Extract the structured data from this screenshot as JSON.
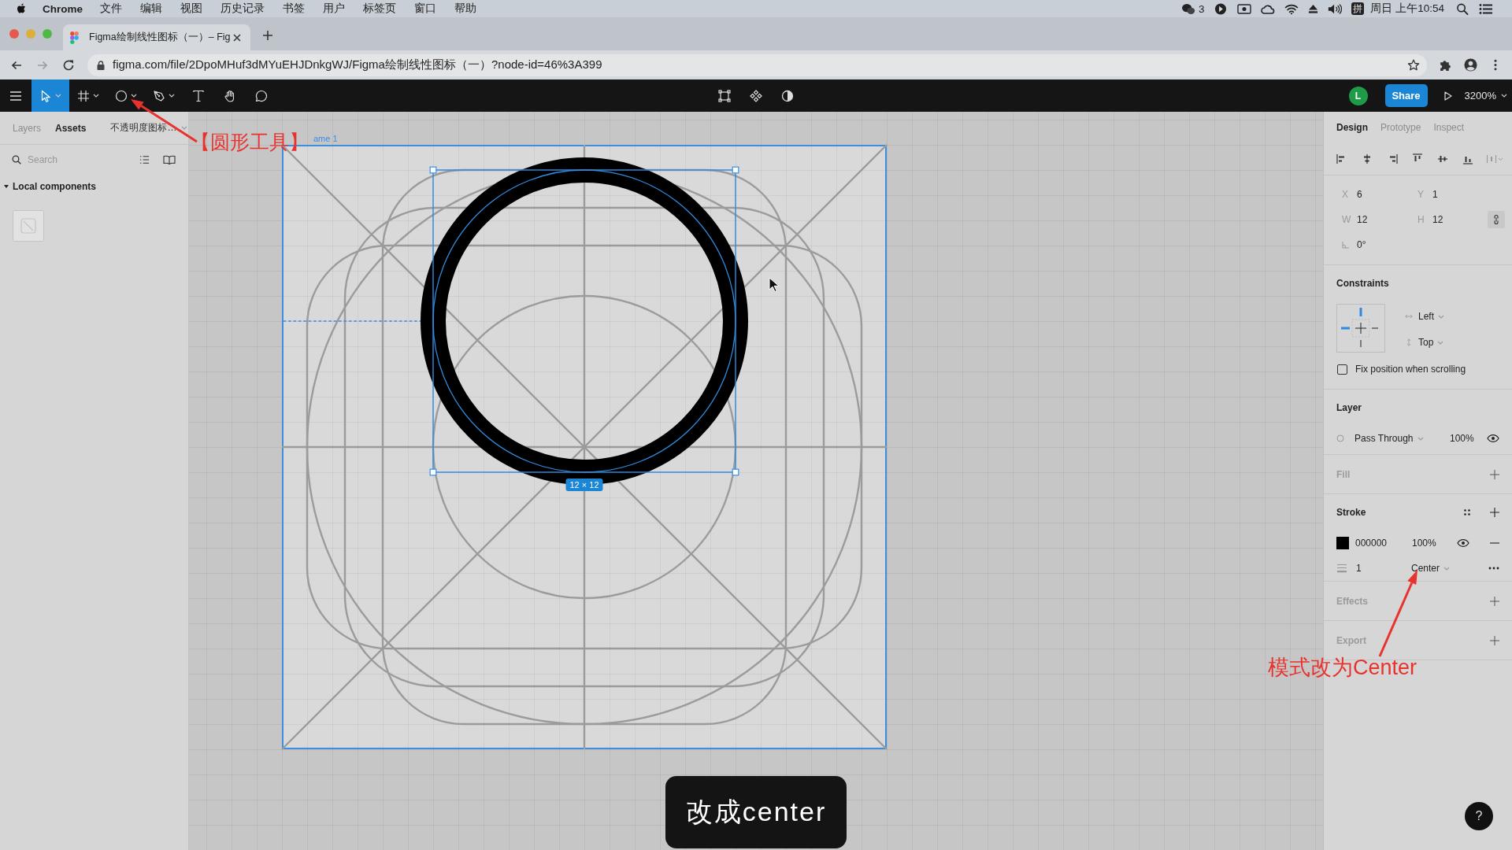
{
  "menu_bar": {
    "app": "Chrome",
    "menus": [
      "文件",
      "编辑",
      "视图",
      "历史记录",
      "书签",
      "用户",
      "标签页",
      "窗口",
      "帮助"
    ],
    "chat_count": "3",
    "input_method": "拼",
    "clock": "周日 上午10:54"
  },
  "browser": {
    "tabs": [
      {
        "title": "Figma绘制线性图标（一）– Fig",
        "selected": true
      }
    ],
    "forward_disabled": true,
    "url": "figma.com/file/2DpoMHuf3dMYuEHJDnkgWJ/Figma绘制线性图标（一）?node-id=46%3A399"
  },
  "toolbar": {
    "tools": [
      {
        "selected": true
      },
      {
        "selected": false
      },
      {
        "selected": false
      },
      {
        "selected": false
      },
      {
        "selected": false
      },
      {
        "selected": false
      },
      {
        "selected": false
      }
    ],
    "avatar": "L",
    "share": "Share",
    "zoom": "3200%"
  },
  "left_panel": {
    "tabs": [
      {
        "label": "Layers",
        "selected": false
      },
      {
        "label": "Assets",
        "selected": true
      }
    ],
    "page": "不透明度图标…",
    "search": {
      "placeholder": "Search"
    },
    "section": {
      "title": "Local components",
      "expanded": true
    }
  },
  "canvas": {
    "frame_label": "ame 1",
    "selection_size": "12 × 12"
  },
  "right_panel": {
    "tabs": [
      {
        "label": "Design",
        "selected": true
      },
      {
        "label": "Prototype",
        "selected": false
      },
      {
        "label": "Inspect",
        "selected": false
      }
    ],
    "position": [
      {
        "label": "X",
        "value": "6"
      },
      {
        "label": "Y",
        "value": "1"
      },
      {
        "label": "W",
        "value": "12"
      },
      {
        "label": "H",
        "value": "12"
      }
    ],
    "rotation": "0°",
    "constraints": {
      "title": "Constraints",
      "empty": false,
      "horizontal": "Left",
      "vertical": "Top",
      "fix_position": {
        "label": "Fix position when scrolling",
        "checked": false
      }
    },
    "layer": {
      "title": "Layer",
      "empty": false,
      "blend": "Pass Through",
      "opacity": "100%"
    },
    "fill": {
      "title": "Fill",
      "empty": true
    },
    "stroke": {
      "title": "Stroke",
      "empty": false,
      "color": "000000",
      "opacity": "100%",
      "weight": "1",
      "align": "Center"
    },
    "effects": {
      "title": "Effects",
      "empty": true
    },
    "export": {
      "title": "Export",
      "empty": true
    },
    "help": "?"
  },
  "annotations": [
    {
      "text": "【圆形工具】"
    },
    {
      "text": "模式改为Center"
    }
  ],
  "caption": "改成center"
}
